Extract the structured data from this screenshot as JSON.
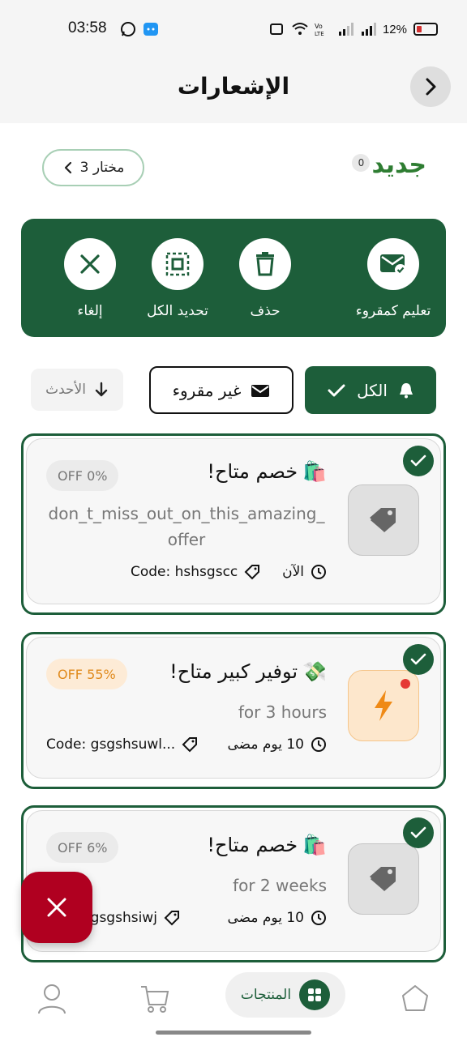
{
  "status": {
    "time": "03:58",
    "battery": "12%"
  },
  "header": {
    "title": "الإشعارات"
  },
  "new_section": {
    "label": "جديد",
    "count": "0",
    "selected_label": "3 مختار"
  },
  "actions": {
    "mark_read": "تعليم كمقروء",
    "delete": "حذف",
    "select_all": "تحديد الكل",
    "cancel": "إلغاء"
  },
  "filters": {
    "all": "الكل",
    "unread": "غير مقروء",
    "sort": "الأحدث"
  },
  "notifications": [
    {
      "title": "خصم متاح!",
      "emoji": "🛍️",
      "body": "don_t_miss_out_on_this_amazing_offer",
      "time": "الآن",
      "code": "Code: hshsgscc",
      "discount": "OFF 0%"
    },
    {
      "title": "توفير كبير متاح!",
      "emoji": "💸",
      "body": "for 3 hours",
      "time": "10  يوم مضى",
      "code": "Code: gsgshsuwl...",
      "discount": "OFF 55%"
    },
    {
      "title": "خصم متاح!",
      "emoji": "🛍️",
      "body": "for 2 weeks",
      "time": "10  يوم مضى",
      "code": "Code: gsgshsiwj",
      "discount": "OFF 6%"
    }
  ],
  "bottom_nav": {
    "products": "المنتجات"
  },
  "colors": {
    "primary": "#1d5e3a",
    "accent_green": "#2e7d32",
    "danger": "#b00020",
    "orange": "#e08a1c"
  }
}
